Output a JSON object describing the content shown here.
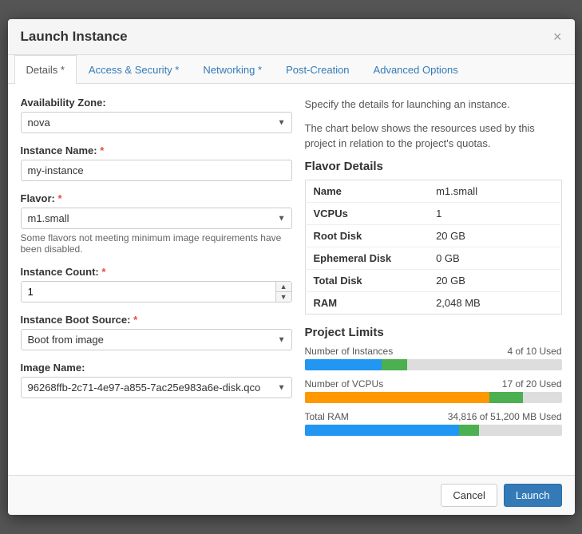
{
  "modal": {
    "title": "Launch Instance",
    "close_label": "×"
  },
  "tabs": [
    {
      "id": "details",
      "label": "Details *",
      "active": true
    },
    {
      "id": "access-security",
      "label": "Access & Security *",
      "active": false
    },
    {
      "id": "networking",
      "label": "Networking *",
      "active": false
    },
    {
      "id": "post-creation",
      "label": "Post-Creation",
      "active": false
    },
    {
      "id": "advanced-options",
      "label": "Advanced Options",
      "active": false
    }
  ],
  "form": {
    "availability_zone_label": "Availability Zone:",
    "availability_zone_value": "nova",
    "instance_name_label": "Instance Name:",
    "instance_name_required": "*",
    "instance_name_value": "my-instance",
    "flavor_label": "Flavor:",
    "flavor_required": "*",
    "flavor_value": "m1.small",
    "flavor_hint": "Some flavors not meeting minimum image requirements have been disabled.",
    "instance_count_label": "Instance Count:",
    "instance_count_required": "*",
    "instance_count_value": "1",
    "instance_boot_source_label": "Instance Boot Source:",
    "instance_boot_source_required": "*",
    "instance_boot_source_value": "Boot from image",
    "image_name_label": "Image Name:",
    "image_name_value": "96268ffb-2c71-4e97-a855-7ac25e983a6e-disk.qco"
  },
  "right_panel": {
    "desc1": "Specify the details for launching an instance.",
    "desc2": "The chart below shows the resources used by this project in relation to the project's quotas.",
    "flavor_details_title": "Flavor Details",
    "flavor_rows": [
      {
        "label": "Name",
        "value": "m1.small"
      },
      {
        "label": "VCPUs",
        "value": "1"
      },
      {
        "label": "Root Disk",
        "value": "20 GB"
      },
      {
        "label": "Ephemeral Disk",
        "value": "0 GB"
      },
      {
        "label": "Total Disk",
        "value": "20 GB"
      },
      {
        "label": "RAM",
        "value": "2,048 MB"
      }
    ],
    "project_limits_title": "Project Limits",
    "limits": [
      {
        "label": "Number of Instances",
        "used_text": "4 of 10 Used",
        "blue_pct": 30,
        "green_pct": 10
      },
      {
        "label": "Number of VCPUs",
        "used_text": "17 of 20 Used",
        "orange_pct": 72,
        "green_pct": 13
      },
      {
        "label": "Total RAM",
        "used_text": "34,816 of 51,200 MB Used",
        "blue_pct": 60,
        "green_pct": 8
      }
    ]
  },
  "footer": {
    "cancel_label": "Cancel",
    "launch_label": "Launch"
  }
}
